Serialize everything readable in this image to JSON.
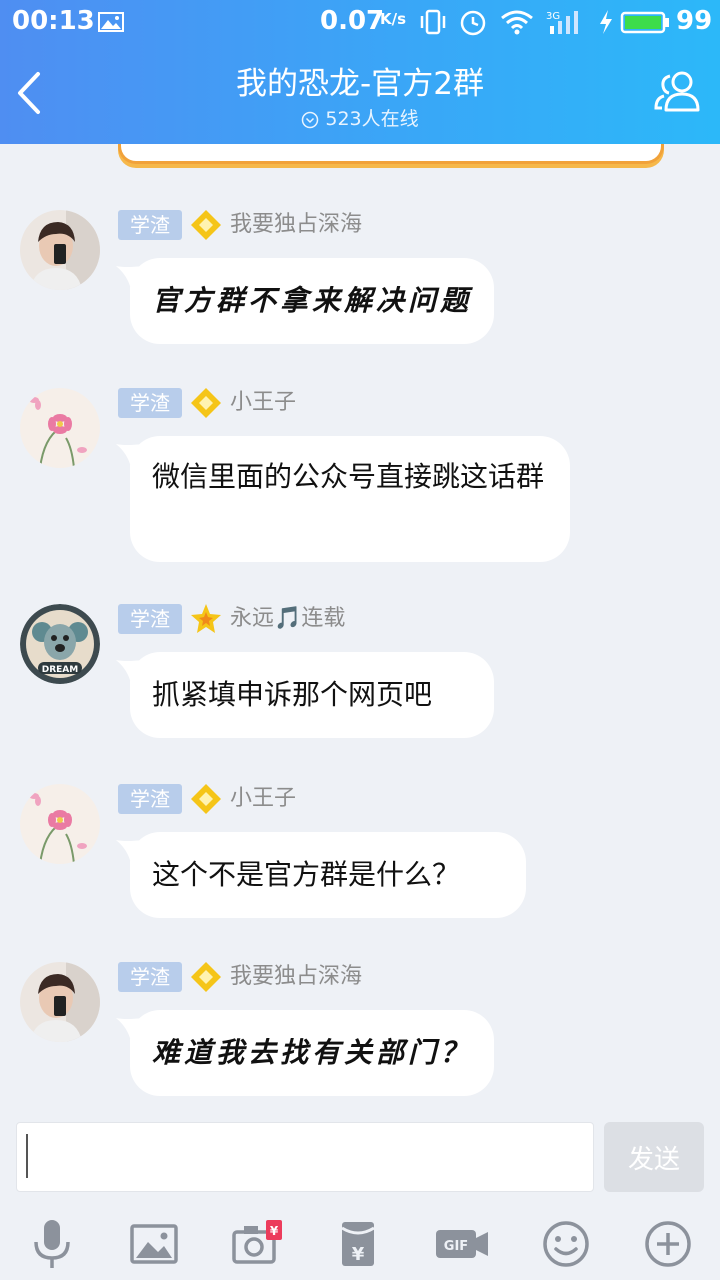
{
  "status_bar": {
    "time": "00:13",
    "speed": "0.07",
    "speed_unit": "K/s",
    "battery": "99",
    "network": "3G"
  },
  "header": {
    "title": "我的恐龙-官方2群",
    "online": "523人在线",
    "back_icon": "chevron-left-icon",
    "members_icon": "group-members-icon"
  },
  "messages": [
    {
      "badge": "学渣",
      "rank": "diamond",
      "nickname": "我要独占深海",
      "text": "官方群不拿来解决问题",
      "avatar": "boy-selfie"
    },
    {
      "badge": "学渣",
      "rank": "diamond",
      "nickname": "小王子",
      "text": "微信里面的公众号直接跳这话群",
      "avatar": "pink-flower"
    },
    {
      "badge": "学渣",
      "rank": "star",
      "nickname": "永远🎵连载",
      "text": "抓紧填申诉那个网页吧",
      "avatar": "dream-koala"
    },
    {
      "badge": "学渣",
      "rank": "diamond",
      "nickname": "小王子",
      "text": "这个不是官方群是什么？",
      "avatar": "pink-flower"
    },
    {
      "badge": "学渣",
      "rank": "diamond",
      "nickname": "我要独占深海",
      "text": "难道我去找有关部门？",
      "avatar": "boy-selfie"
    }
  ],
  "input": {
    "value": "",
    "placeholder": "",
    "send_label": "发送"
  },
  "toolbar": [
    {
      "icon": "microphone-icon"
    },
    {
      "icon": "image-icon"
    },
    {
      "icon": "camera-icon",
      "badge": "¥"
    },
    {
      "icon": "red-packet-icon",
      "badge": "¥"
    },
    {
      "icon": "gif-icon",
      "label": "GIF"
    },
    {
      "icon": "emoji-icon"
    },
    {
      "icon": "plus-icon"
    }
  ],
  "colors": {
    "header_start": "#4f8ef2",
    "header_end": "#2cb8f9",
    "chat_bg": "#eef1f6",
    "bubble": "#ffffff",
    "badge": "#b8cdeb",
    "nickname": "#8c8c8c",
    "icon_gray": "#8c929c",
    "rank_gold": "#f5c518"
  }
}
